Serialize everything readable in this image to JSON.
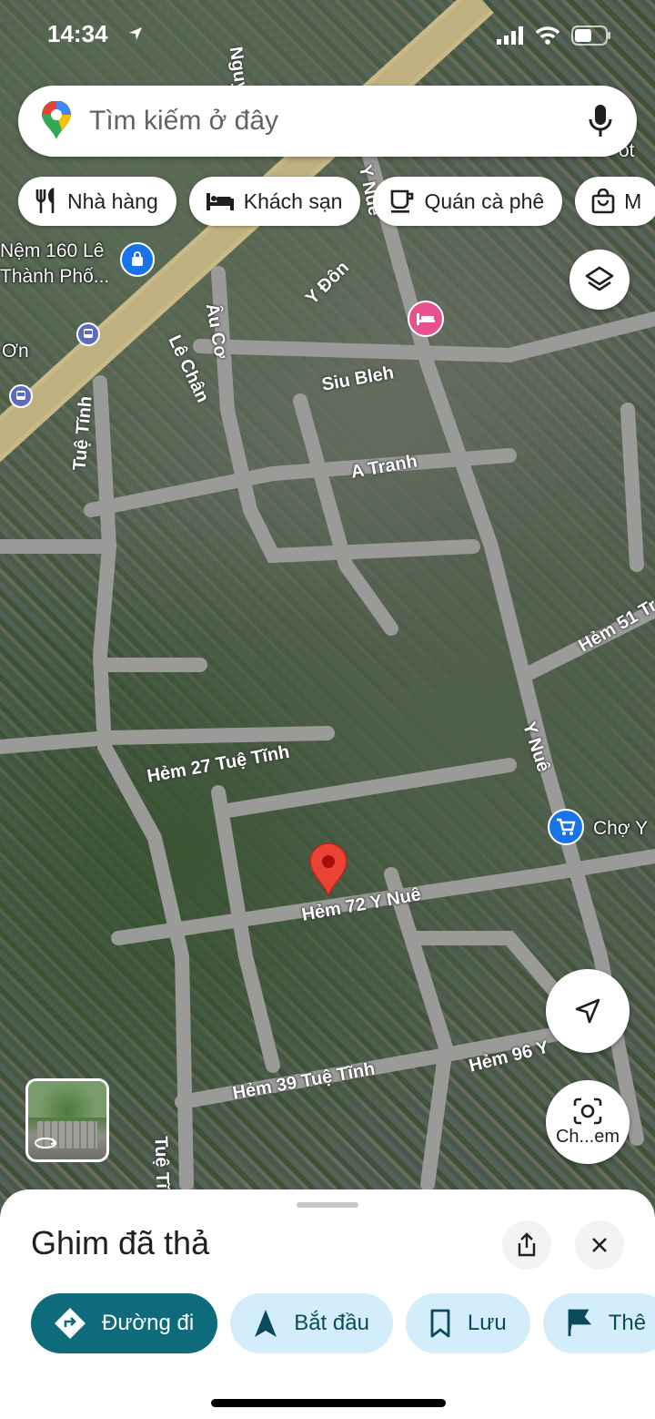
{
  "status_bar": {
    "time": "14:34"
  },
  "search": {
    "placeholder": "Tìm kiếm ở đây"
  },
  "chips": [
    {
      "label": "Nhà hàng",
      "icon": "restaurant-icon"
    },
    {
      "label": "Khách sạn",
      "icon": "hotel-icon"
    },
    {
      "label": "Quán cà phê",
      "icon": "coffee-icon"
    },
    {
      "label": "M",
      "icon": "shopping-bag-icon"
    }
  ],
  "map": {
    "roads": [
      {
        "label": "Nguyễn V"
      },
      {
        "label": "Y Nuê"
      },
      {
        "label": "Y Đôn"
      },
      {
        "label": "Âu Cơ"
      },
      {
        "label": "Lê Chân"
      },
      {
        "label": "Siu Bleh"
      },
      {
        "label": "Tuệ Tĩnh"
      },
      {
        "label": "A Tranh"
      },
      {
        "label": "Hẻm 51 Tr"
      },
      {
        "label": "Y Nuê"
      },
      {
        "label": "Hẻm 27 Tuệ Tĩnh"
      },
      {
        "label": "Hẻm 72 Y Nuê"
      },
      {
        "label": "Hẻm 96 Y"
      },
      {
        "label": "Hẻm 39 Tuệ Tĩnh"
      },
      {
        "label": "Tuệ Tĩn"
      }
    ],
    "pois": {
      "shop_name_line1": "Nệm 160 Lê",
      "shop_name_line2": "Thành Phố...",
      "partial_left": "Ơn",
      "market": "Chợ Y",
      "partial_right": "ot"
    },
    "lens_label": "Ch...em"
  },
  "sheet": {
    "title": "Ghim đã thả",
    "actions": [
      {
        "label": "Đường đi",
        "icon": "directions-icon"
      },
      {
        "label": "Bắt đầu",
        "icon": "navigation-arrow-icon"
      },
      {
        "label": "Lưu",
        "icon": "bookmark-icon"
      },
      {
        "label": "Thê",
        "icon": "flag-icon"
      }
    ]
  },
  "colors": {
    "accent": "#0e6b7c",
    "action_bg": "#d3eefa",
    "pin_red": "#ea4335",
    "hotel_pink": "#e8508f",
    "shop_blue": "#1a73e8"
  }
}
